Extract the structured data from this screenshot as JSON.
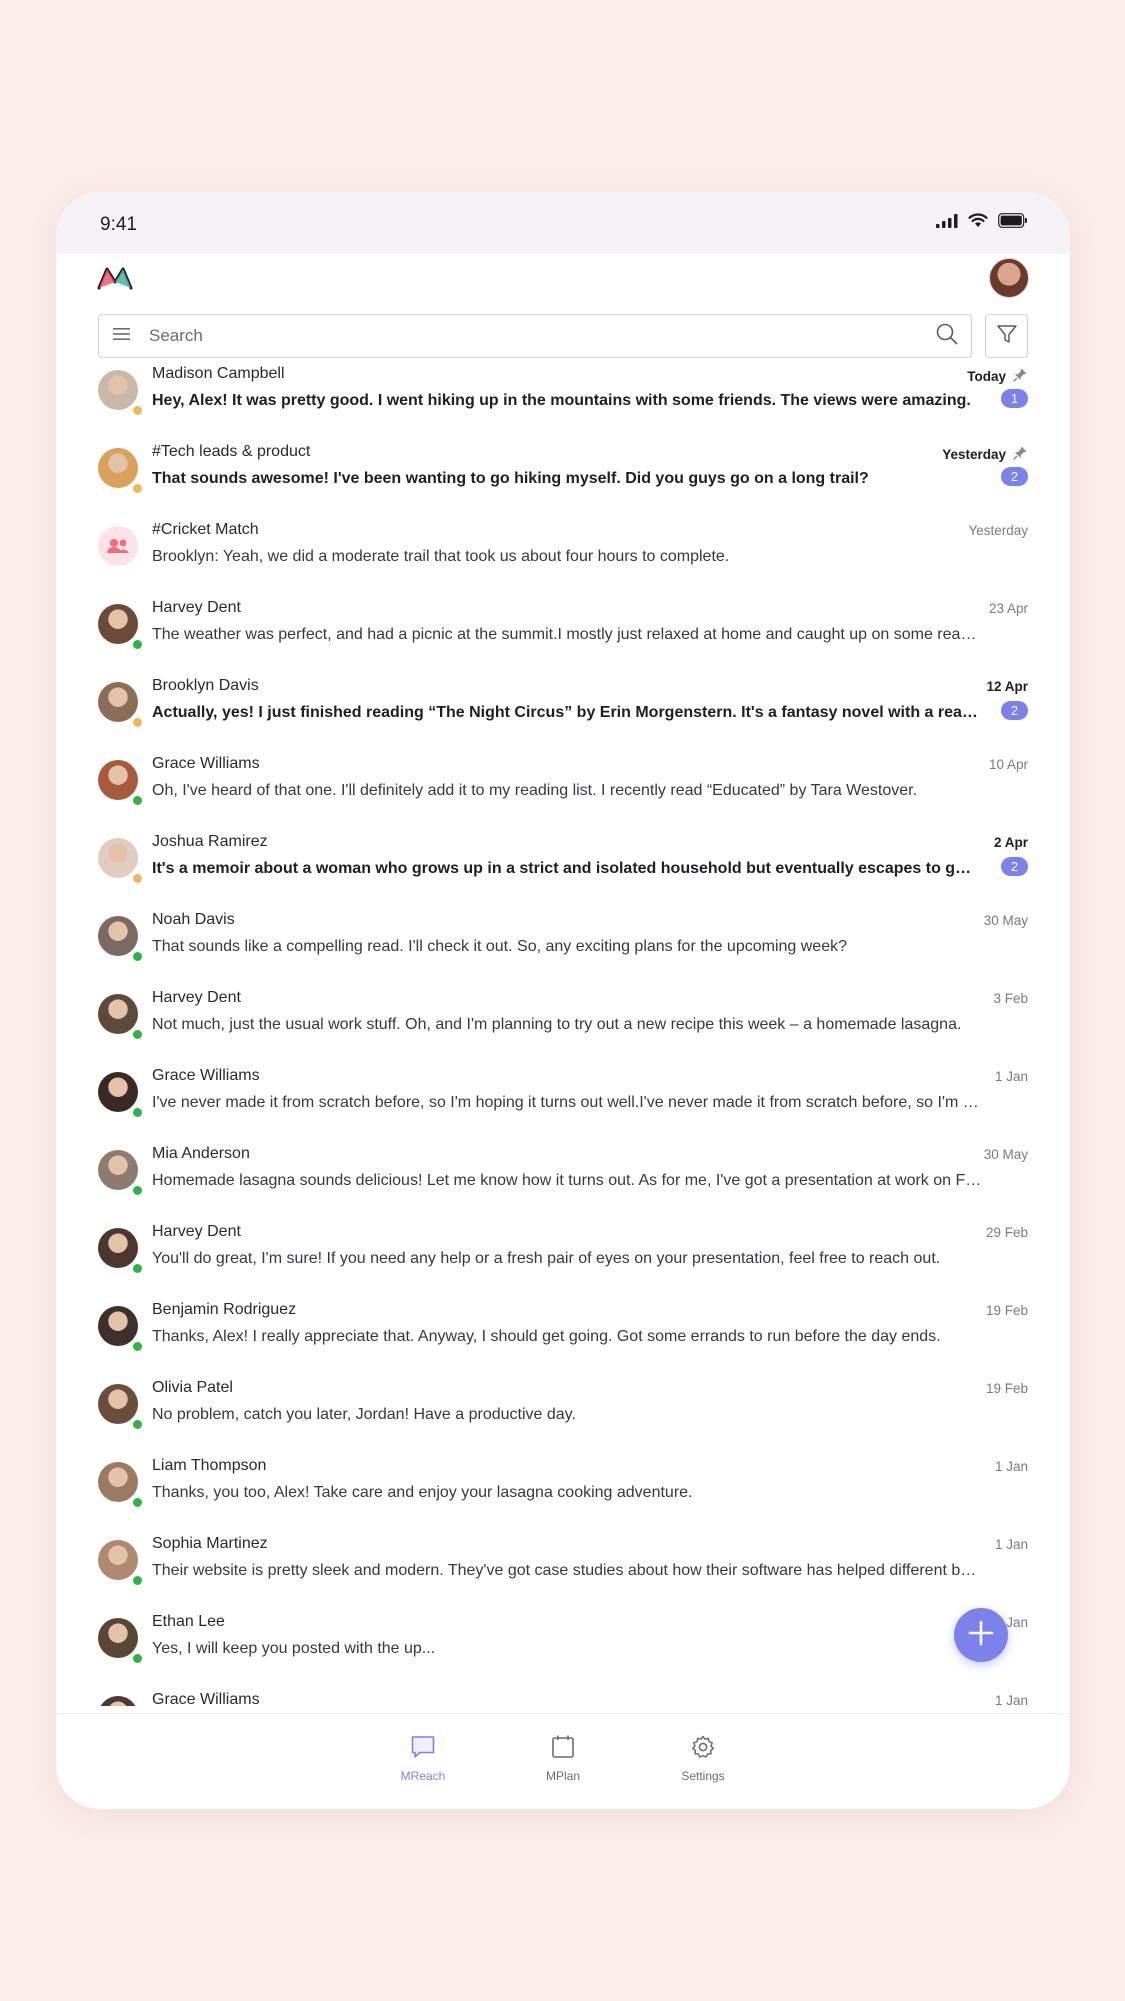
{
  "status_bar": {
    "time": "9:41"
  },
  "search": {
    "placeholder": "Search",
    "value": ""
  },
  "conversations": [
    {
      "name": "Madison Campbell",
      "message": "Hey, Alex! It was pretty good. I went hiking up in the mountains with some friends. The views were amazing.",
      "date": "Today",
      "unread": 1,
      "pinned": true,
      "presence": "away",
      "avatar": "#c9b8a8"
    },
    {
      "name": "#Tech leads & product",
      "message": "That sounds awesome! I've been wanting to go hiking myself. Did you guys go on a long trail?",
      "date": "Yesterday",
      "unread": 2,
      "pinned": true,
      "presence": "away",
      "avatar": "#d9a15c"
    },
    {
      "name": "#Cricket Match",
      "message": "Brooklyn: Yeah, we did a moderate trail that took us about four hours to complete.",
      "date": "Yesterday",
      "unread": 0,
      "pinned": false,
      "presence": "none",
      "avatar": "group"
    },
    {
      "name": "Harvey Dent",
      "message": "The weather was perfect, and  had a picnic at the summit.I mostly just relaxed at home and caught up on some reading...",
      "date": "23 Apr",
      "unread": 0,
      "pinned": false,
      "presence": "online",
      "avatar": "#6b4a3a"
    },
    {
      "name": "Brooklyn Davis",
      "message": "Actually, yes! I just finished reading “The Night Circus” by Erin Morgenstern. It's a fantasy novel with a really unique premise and beautiful writing.",
      "date": "12 Apr",
      "unread": 2,
      "pinned": false,
      "presence": "away",
      "avatar": "#8a6e58"
    },
    {
      "name": "Grace Williams",
      "message": "Oh, I've heard of that one. I'll definitely add it to my reading list. I recently read “Educated” by Tara Westover.",
      "date": "10 Apr",
      "unread": 0,
      "pinned": false,
      "presence": "online",
      "avatar": "#a85a3e"
    },
    {
      "name": "Joshua Ramirez",
      "message": "It's a memoir about a woman who grows up in a strict and isolated household but eventually escapes to get an education.",
      "date": "2 Apr",
      "unread": 2,
      "pinned": false,
      "presence": "away",
      "avatar": "#e0cdbf"
    },
    {
      "name": "Noah Davis",
      "message": "That sounds like a compelling read. I'll check it out. So, any exciting plans for the upcoming week?",
      "date": "30 May",
      "unread": 0,
      "pinned": false,
      "presence": "online",
      "avatar": "#7a6a62"
    },
    {
      "name": "Harvey Dent",
      "message": "Not much, just the usual work stuff. Oh, and I'm planning to try out a new recipe this week – a homemade lasagna.",
      "date": "3 Feb",
      "unread": 0,
      "pinned": false,
      "presence": "online",
      "avatar": "#5e4a3a"
    },
    {
      "name": "Grace Williams",
      "message": "I've never made it from scratch before, so I'm hoping it turns out well.I've never made it from scratch before, so I'm hoping it turns out well.",
      "date": "1 Jan",
      "unread": 0,
      "pinned": false,
      "presence": "online",
      "avatar": "#3a2a26"
    },
    {
      "name": "Mia Anderson",
      "message": "Homemade lasagna sounds delicious! Let me know how it turns out. As for me, I've got a presentation at work on Friday,",
      "date": "30 May",
      "unread": 0,
      "pinned": false,
      "presence": "online",
      "avatar": "#8c7c70"
    },
    {
      "name": "Harvey Dent",
      "message": "You'll do great, I'm sure! If you need any help or a fresh pair of eyes on your presentation, feel free to reach out.",
      "date": "29 Feb",
      "unread": 0,
      "pinned": false,
      "presence": "online",
      "avatar": "#4a3830"
    },
    {
      "name": "Benjamin Rodriguez",
      "message": "Thanks, Alex! I really appreciate that. Anyway, I should get going. Got some errands to run before the day ends.",
      "date": "19 Feb",
      "unread": 0,
      "pinned": false,
      "presence": "online",
      "avatar": "#3e302a"
    },
    {
      "name": "Olivia Patel",
      "message": "No problem, catch you later, Jordan! Have a productive day.",
      "date": "19 Feb",
      "unread": 0,
      "pinned": false,
      "presence": "online",
      "avatar": "#6a4e3c"
    },
    {
      "name": "Liam Thompson",
      "message": "Thanks, you too, Alex! Take care and enjoy your lasagna cooking adventure.",
      "date": "1 Jan",
      "unread": 0,
      "pinned": false,
      "presence": "online",
      "avatar": "#9a7a60"
    },
    {
      "name": "Sophia Martinez",
      "message": "Their website is pretty sleek and modern. They've got case studies about how their software has helped different businesses.",
      "date": "1 Jan",
      "unread": 0,
      "pinned": false,
      "presence": "online",
      "avatar": "#b08a70"
    },
    {
      "name": "Ethan Lee",
      "message": "Yes, I will keep you posted with the up...",
      "date": "1 Jan",
      "unread": 0,
      "pinned": false,
      "presence": "online",
      "avatar": "#5a4634"
    },
    {
      "name": "Grace Williams",
      "message": "",
      "date": "1 Jan",
      "unread": 0,
      "pinned": false,
      "presence": "online",
      "avatar": "#4a3a32"
    }
  ],
  "tabs": [
    {
      "label": "MReach",
      "icon": "chat-icon",
      "active": true
    },
    {
      "label": "MPlan",
      "icon": "calendar-icon",
      "active": false
    },
    {
      "label": "Settings",
      "icon": "gear-icon",
      "active": false
    }
  ],
  "colors": {
    "accent": "#7b83eb",
    "online": "#2fb344",
    "away": "#f2b857",
    "background": "#fbecea"
  }
}
